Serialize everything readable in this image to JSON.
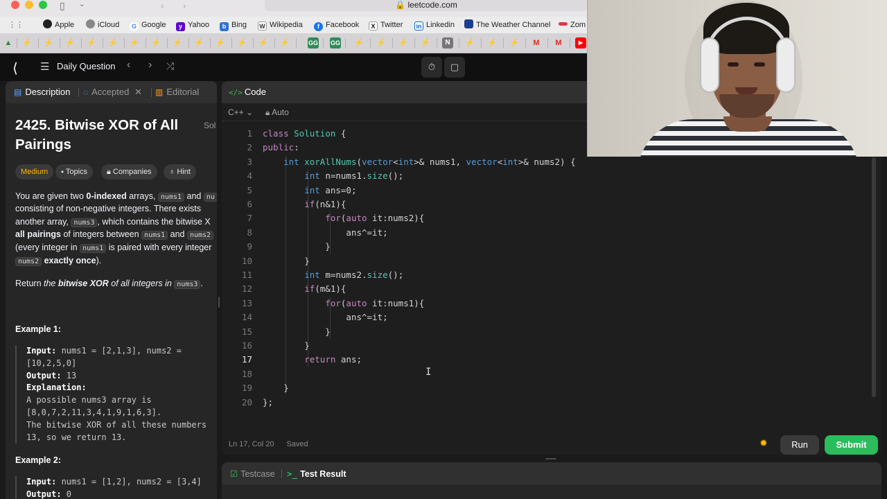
{
  "browser": {
    "url": "leetcode.com",
    "favorites": [
      {
        "label": "Apple",
        "icon": "apple-icon",
        "color": "#222222"
      },
      {
        "label": "iCloud",
        "icon": "apple-icon",
        "color": "#888888"
      },
      {
        "label": "Google",
        "icon": "google-icon",
        "color": "#4285f4"
      },
      {
        "label": "Yahoo",
        "icon": "yahoo-icon",
        "color": "#6001d2"
      },
      {
        "label": "Bing",
        "icon": "bing-icon",
        "color": "#2f6fd6"
      },
      {
        "label": "Wikipedia",
        "icon": "wikipedia-icon",
        "color": "#333333"
      },
      {
        "label": "Facebook",
        "icon": "facebook-icon",
        "color": "#1877f2"
      },
      {
        "label": "Twitter",
        "icon": "x-icon",
        "color": "#111111"
      },
      {
        "label": "Linkedin",
        "icon": "linkedin-icon",
        "color": "#0a66c2"
      },
      {
        "label": "The Weather Channel",
        "icon": "weather-icon",
        "color": "#1b3f8f"
      },
      {
        "label": "Zom",
        "icon": "zomato-icon",
        "color": "#e23744"
      }
    ]
  },
  "nav": {
    "title": "Daily Question"
  },
  "left_panel": {
    "tabs": {
      "description": "Description",
      "accepted": "Accepted",
      "editorial": "Editorial",
      "solutions_clip": "Sol"
    },
    "problem_title_line1": "2425. Bitwise XOR of All",
    "problem_title_line2": "Pairings",
    "chips": {
      "difficulty": "Medium",
      "topics": "Topics",
      "companies": "Companies",
      "hint": "Hint"
    },
    "description": {
      "l1_a": "You are given two ",
      "l1_b": "0-indexed",
      "l1_c": " arrays, ",
      "l1_code1": "nums1",
      "l1_d": " and ",
      "l1_code2": "nu",
      "l2": "consisting of non-negative integers. There exists",
      "l3_a": "another array, ",
      "l3_code": "nums3",
      "l3_b": ", which contains the bitwise X",
      "l4_a": "all pairings",
      "l4_b": " of integers between ",
      "l4_code1": "nums1",
      "l4_c": " and ",
      "l4_code2": "nums2",
      "l5_a": "(every integer in ",
      "l5_code": "nums1",
      "l5_b": " is paired with every integer",
      "l6_code": "nums2",
      "l6_a": " exactly once",
      "l6_b": ").",
      "l7_a": "Return ",
      "l7_b": "the ",
      "l7_c": "bitwise XOR",
      "l7_d": " of all integers in ",
      "l7_code": "nums3",
      "l7_e": "."
    },
    "example1": {
      "title": "Example 1:",
      "input_label": "Input:",
      "input_l1": " nums1 = [2,1,3], nums2 =",
      "input_l2": "[10,2,5,0]",
      "output_label": "Output:",
      "output": " 13",
      "explanation_label": "Explanation:",
      "exp_l1": "A possible nums3 array is",
      "exp_l2": "[8,0,7,2,11,3,4,1,9,1,6,3].",
      "exp_l3": "The bitwise XOR of all these numbers",
      "exp_l4": "13, so we return 13."
    },
    "example2": {
      "title": "Example 2:",
      "input_label": "Input:",
      "input_l1": " nums1 = [1,2], nums2 = [3,4]",
      "output_label": "Output:",
      "output": " 0"
    }
  },
  "code_panel": {
    "tab_label": "Code",
    "language": "C++",
    "mode": "Auto",
    "current_line": 17,
    "lines": [
      "class Solution {",
      "public:",
      "    int xorAllNums(vector<int>& nums1, vector<int>& nums2) {",
      "        int n=nums1.size();",
      "        int ans=0;",
      "        if(n&1){",
      "            for(auto it:nums2){",
      "                ans^=it;",
      "            }",
      "        }",
      "        int m=nums2.size();",
      "        if(m&1){",
      "            for(auto it:nums1){",
      "                ans^=it;",
      "            }",
      "        }",
      "        return ans;",
      "",
      "    }",
      "};"
    ],
    "status_position": "Ln 17, Col 20",
    "status_saved": "Saved",
    "run_label": "Run",
    "submit_label": "Submit"
  },
  "bottom_panel": {
    "testcase_label": "Testcase",
    "test_result_label": "Test Result"
  },
  "colors": {
    "accent_green": "#2cbb5d",
    "medium": "#ffb800",
    "keyword": "#c586c0",
    "type": "#569cd6",
    "class_name": "#4ec9b0"
  }
}
